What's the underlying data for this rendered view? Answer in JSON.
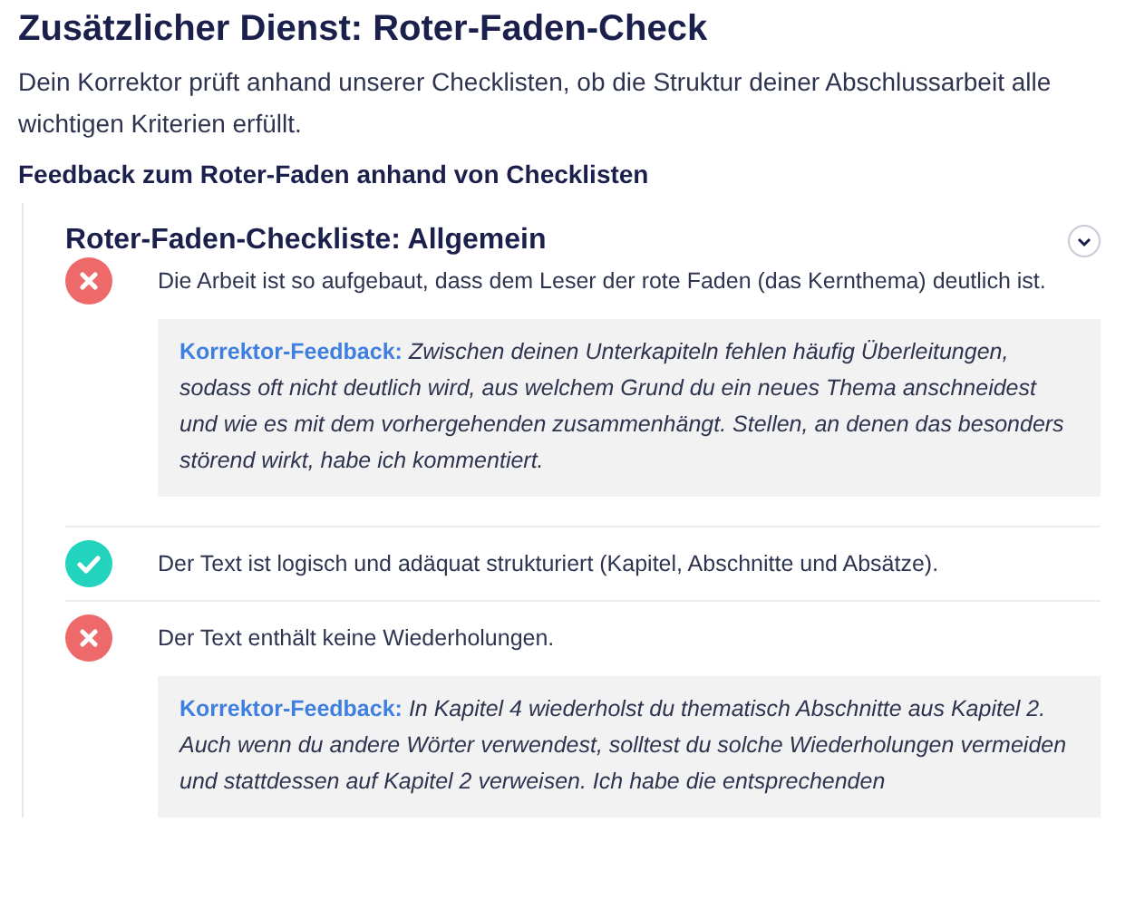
{
  "title": "Zusätzlicher Dienst: Roter-Faden-Check",
  "description": "Dein Korrektor prüft anhand unserer Checklisten, ob die Struktur deiner Abschlussarbeit alle wichtigen Kriterien erfüllt.",
  "subheading": "Feedback zum Roter-Faden anhand von Checklisten",
  "checklist": {
    "title": "Roter-Faden-Checkliste: Allgemein",
    "expanded": true,
    "items": [
      {
        "text": "Die Arbeit ist so aufgebaut, dass dem Leser der rote Faden (das Kernthema) deutlich ist.",
        "passed": false,
        "feedback_label": "Korrektor-Feedback:",
        "feedback": "Zwischen deinen Unterkapiteln fehlen häufig Überleitungen, sodass oft nicht deutlich wird, aus welchem Grund du ein neues Thema anschneidest und wie es mit dem vorhergehenden zusammenhängt. Stellen, an denen das besonders störend wirkt, habe ich kommentiert."
      },
      {
        "text": "Der Text ist logisch und adäquat strukturiert (Kapitel, Abschnitte und Absätze).",
        "passed": true
      },
      {
        "text": "Der Text enthält keine Wiederholungen.",
        "passed": false,
        "feedback_label": "Korrektor-Feedback:",
        "feedback": "In Kapitel 4 wiederholst du thematisch Abschnitte aus Kapitel 2. Auch wenn du andere Wörter verwendest, solltest du solche Wiederholungen vermeiden und stattdessen auf Kapitel 2 verweisen. Ich habe die entsprechenden"
      }
    ]
  }
}
